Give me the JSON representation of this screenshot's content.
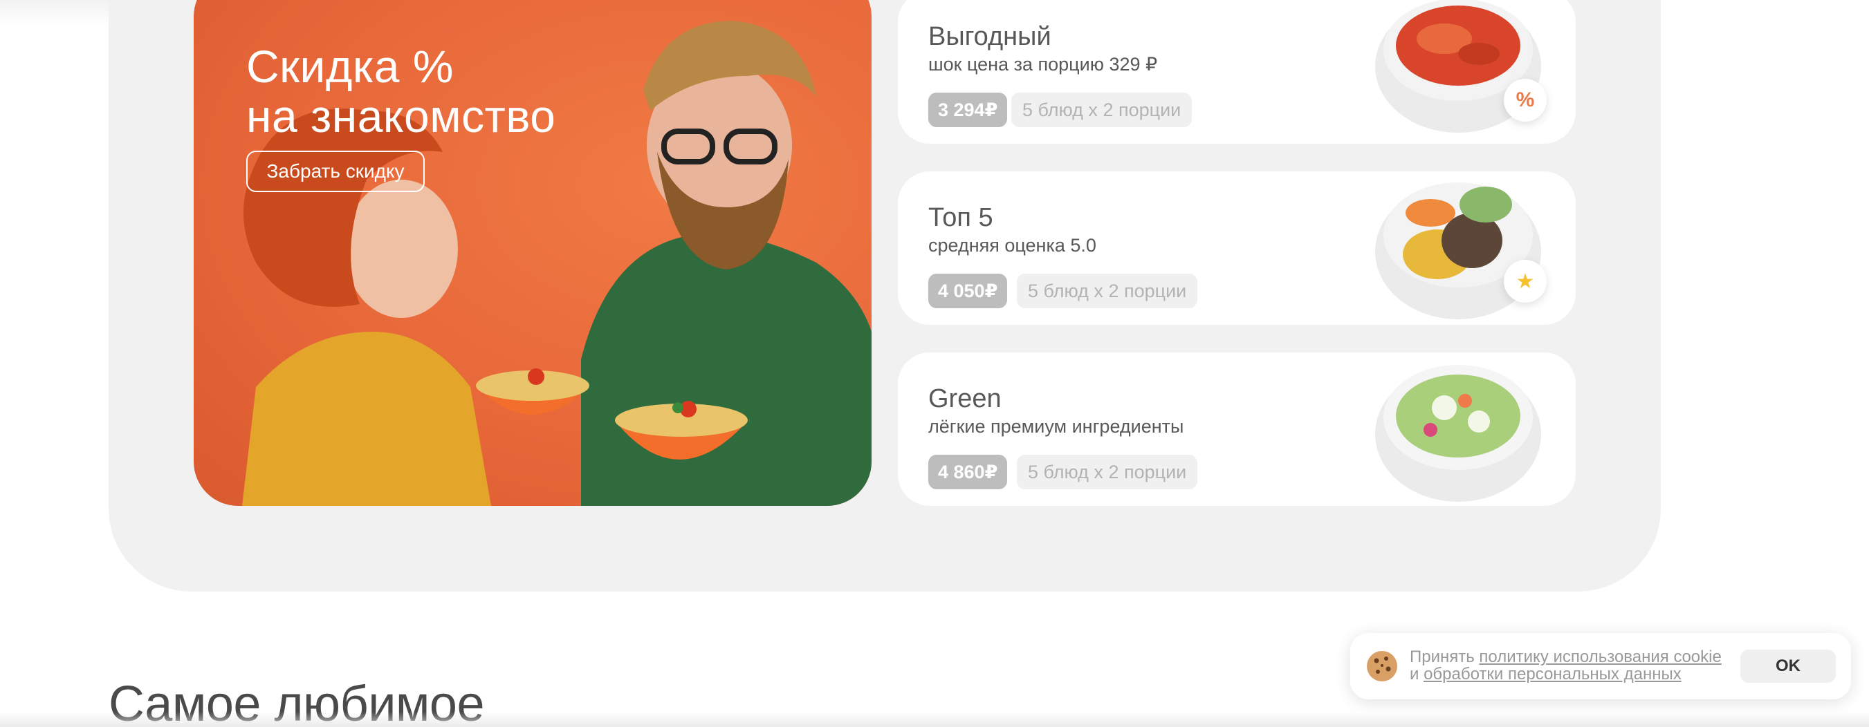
{
  "hero": {
    "title_line1": "Скидка %",
    "title_line2": "на знакомство",
    "button_label": "Забрать скидку",
    "background_color": "#e8683a"
  },
  "cards": [
    {
      "title": "Выгодный",
      "subtitle": "шок цена за порцию 329 ₽",
      "price": "3 294₽",
      "portions": "5 блюд х 2 порции",
      "badge_icon": "percent-icon",
      "badge_glyph": "%"
    },
    {
      "title": "Топ 5",
      "subtitle": "средняя оценка 5.0",
      "price": "4 050₽",
      "portions": "5 блюд х 2 порции",
      "badge_icon": "star-icon",
      "badge_glyph": "★"
    },
    {
      "title": "Green",
      "subtitle": "лёгкие премиум ингредиенты",
      "price": "4 860₽",
      "portions": "5 блюд х 2 порции"
    }
  ],
  "section": {
    "title": "Самое любимое"
  },
  "cookie": {
    "text_prefix": "Принять",
    "policy_link": "политику использования cookie",
    "conjunction": "и",
    "data_link": "обработки персональных данных",
    "ok_label": "OK"
  },
  "colors": {
    "accent": "#e8683a",
    "panel": "#f1f1f1",
    "price_badge": "#bdbdbd",
    "text_dark": "#585858",
    "star": "#f5c12e"
  }
}
